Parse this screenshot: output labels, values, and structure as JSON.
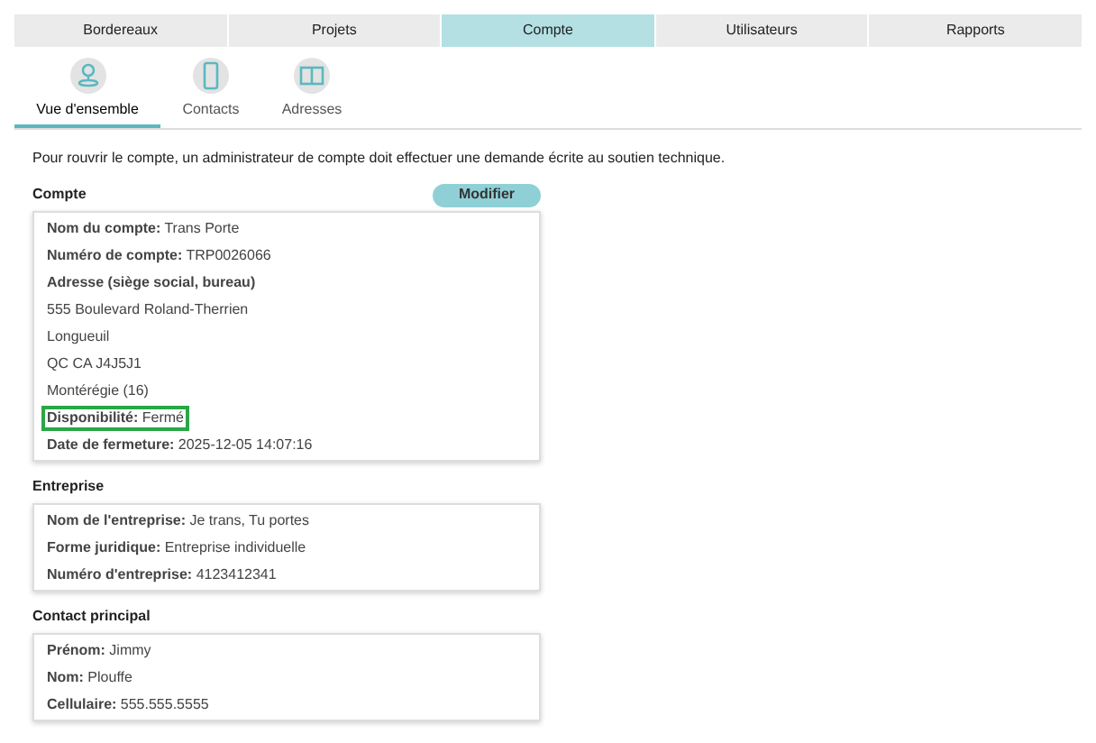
{
  "tabs": [
    {
      "label": "Bordereaux",
      "selected": false
    },
    {
      "label": "Projets",
      "selected": false
    },
    {
      "label": "Compte",
      "selected": true
    },
    {
      "label": "Utilisateurs",
      "selected": false
    },
    {
      "label": "Rapports",
      "selected": false
    }
  ],
  "subtabs": [
    {
      "label": "Vue d'ensemble",
      "selected": true
    },
    {
      "label": "Contacts",
      "selected": false
    },
    {
      "label": "Adresses",
      "selected": false
    }
  ],
  "notice": "Pour rouvrir le compte, un administrateur de compte doit effectuer une demande écrite au soutien technique.",
  "sections": [
    {
      "title": "Compte",
      "button": "Modifier",
      "rows": [
        {
          "text": "**Nom du compte:** Trans Porte",
          "highlighted": false
        },
        {
          "text": "**Numéro de compte:** TRP0026066",
          "highlighted": false
        },
        {
          "text": "**Adresse (siège social, bureau)**",
          "highlighted": false
        },
        {
          "text": "555 Boulevard Roland-Therrien",
          "highlighted": false
        },
        {
          "text": "Longueuil",
          "highlighted": false
        },
        {
          "text": "QC CA J4J5J1",
          "highlighted": false
        },
        {
          "text": "Montérégie (16)",
          "highlighted": false
        },
        {
          "text": "**Disponibilité:** Fermé",
          "highlighted": true
        },
        {
          "text": "**Date de fermeture:** 2025-12-05 14:07:16",
          "highlighted": false
        }
      ]
    },
    {
      "title": "Entreprise",
      "rows": [
        {
          "text": "**Nom de l'entreprise:** Je trans, Tu portes",
          "highlighted": false
        },
        {
          "text": "**Forme juridique:** Entreprise individuelle",
          "highlighted": false
        },
        {
          "text": "**Numéro d'entreprise:** 4123412341",
          "highlighted": false
        }
      ]
    },
    {
      "title": "Contact principal",
      "rows": [
        {
          "text": "**Prénom:** Jimmy",
          "highlighted": false
        },
        {
          "text": "**Nom:** Plouffe",
          "highlighted": false
        },
        {
          "text": "**Cellulaire:** 555.555.5555",
          "highlighted": false
        }
      ]
    }
  ]
}
